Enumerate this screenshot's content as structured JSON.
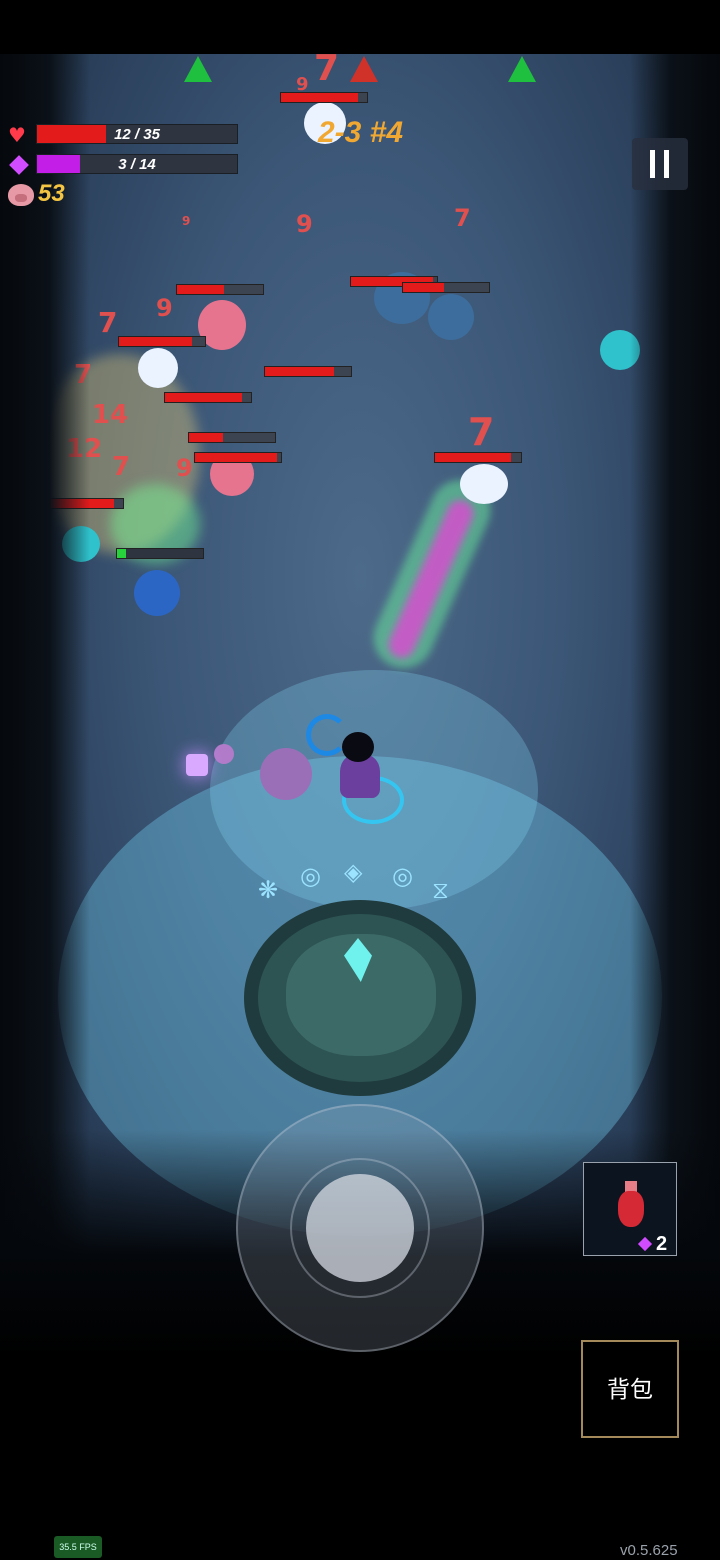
{
  "hud": {
    "hp": {
      "current": 12,
      "max": 35,
      "text": "12 / 35",
      "color": "#e31b1b"
    },
    "mana": {
      "current": 3,
      "max": 14,
      "text": "3 / 14",
      "color": "#c21ee8"
    },
    "pig_count": "53",
    "level_label": "2-3 #4",
    "pause_icon": "pause-icon"
  },
  "damage_numbers": [
    "7",
    "9",
    "9",
    "7",
    "9",
    "7",
    "9",
    "7",
    "7",
    "14",
    "7",
    "7",
    "12",
    "9"
  ],
  "enemy_health": [
    {
      "fill": 0.9
    },
    {
      "fill": 0.55
    },
    {
      "fill": 0.95
    },
    {
      "fill": 0.48
    },
    {
      "fill": 0.85
    },
    {
      "fill": 0.8
    },
    {
      "fill": 0.9
    },
    {
      "fill": 0.4
    },
    {
      "fill": 0.95
    },
    {
      "fill": 0.88
    },
    {
      "fill": 0.9
    }
  ],
  "potion": {
    "icon": "health-potion-icon",
    "count": "2"
  },
  "bag_button": {
    "label": "背包"
  },
  "fps": "35.5 FPS",
  "version": "v0.5.625",
  "colors": {
    "level_text": "#f0a832",
    "pig_count": "#f4c542",
    "aura": "#70cdf0"
  }
}
